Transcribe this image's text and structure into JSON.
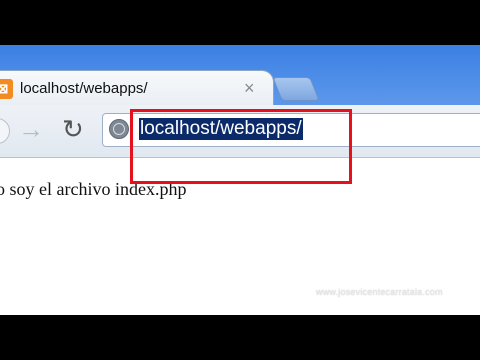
{
  "browser": {
    "tab": {
      "title": "localhost/webapps/",
      "close_glyph": "×",
      "favicon_glyph": "⊠"
    },
    "toolbar": {
      "forward_glyph": "→",
      "reload_glyph": "↻"
    },
    "omnibox": {
      "url": "localhost/webapps/"
    }
  },
  "page": {
    "body_text": "o soy el archivo index.php"
  },
  "overlay": {
    "watermark": "www.josevicentecarratala.com",
    "highlight_color": "#e5121e"
  },
  "colors": {
    "titlebar": "#4f8fe8",
    "url_selection": "#0a2a6a",
    "favicon": "#f28b22"
  }
}
